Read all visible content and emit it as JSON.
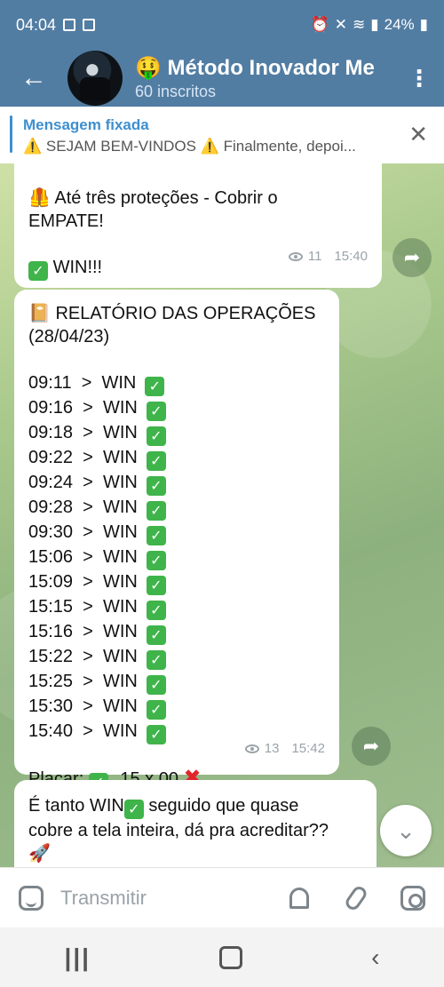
{
  "status": {
    "time": "04:04",
    "battery": "24%"
  },
  "header": {
    "back_glyph": "←",
    "title": "🤑 Método Inovador Me",
    "subtitle": "60 inscritos",
    "menu_glyph": "⋮"
  },
  "pinned": {
    "label": "Mensagem fixada",
    "text": "⚠️ SEJAM BEM-VINDOS ⚠️  Finalmente, depoi...",
    "close_glyph": "✕"
  },
  "messages": [
    {
      "line1": "🦺 Até três proteções - Cobrir o",
      "line2": "EMPATE!",
      "result": "WIN!!!",
      "views": "11",
      "time": "15:40"
    },
    {
      "title": "📔  RELATÓRIO DAS OPERAÇÕES",
      "date": "(28/04/23)",
      "ops": [
        {
          "time": "09:11",
          "result": "WIN"
        },
        {
          "time": "09:16",
          "result": "WIN"
        },
        {
          "time": "09:18",
          "result": "WIN"
        },
        {
          "time": "09:22",
          "result": "WIN"
        },
        {
          "time": "09:24",
          "result": "WIN"
        },
        {
          "time": "09:28",
          "result": "WIN"
        },
        {
          "time": "09:30",
          "result": "WIN"
        },
        {
          "time": "15:06",
          "result": "WIN"
        },
        {
          "time": "15:09",
          "result": "WIN"
        },
        {
          "time": "15:15",
          "result": "WIN"
        },
        {
          "time": "15:16",
          "result": "WIN"
        },
        {
          "time": "15:22",
          "result": "WIN"
        },
        {
          "time": "15:25",
          "result": "WIN"
        },
        {
          "time": "15:30",
          "result": "WIN"
        },
        {
          "time": "15:40",
          "result": "WIN"
        }
      ],
      "score_label": "Placar:",
      "score": "15 x 00",
      "views": "13",
      "time": "15:42"
    },
    {
      "line1a": "É tanto WIN",
      "line1b": " seguido que quase",
      "line2": "cobre a tela inteira, dá pra acreditar??",
      "line3": "🚀"
    }
  ],
  "input": {
    "placeholder": "Transmitir"
  },
  "nav": {
    "recent": "|||",
    "back": "‹"
  }
}
